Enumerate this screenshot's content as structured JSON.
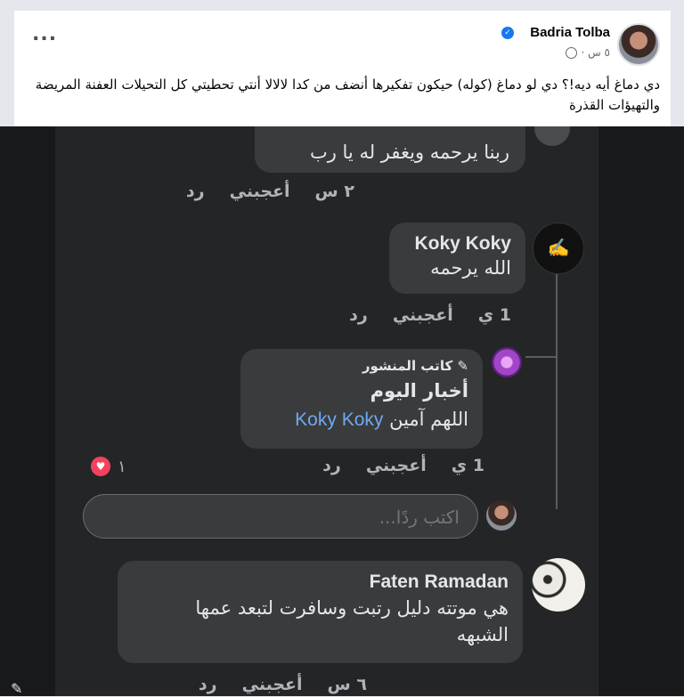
{
  "post": {
    "author": "Badria Tolba",
    "time": "٥ س ·",
    "text": "دي دماغ أيه ديه!؟ دي لو دماغ (كوله) حيكون تفكيرها أنضف من كدا لالالا أنتي تحطيتي كل التحيلات العفنة المريضة والتهيؤات القذرة",
    "more_label": "..."
  },
  "comments": {
    "top_partial": {
      "text": "ربنا يرحمه ويغفر له يا رب",
      "time": "٢ س",
      "like": "أعجبني",
      "reply": "رد"
    },
    "koky": {
      "name": "Koky Koky",
      "text": "الله يرحمه",
      "time": "1 ي",
      "like": "أعجبني",
      "reply": "رد"
    },
    "author_reply": {
      "badge": "كاتب المنشور",
      "name": "أخبار اليوم",
      "mention": "Koky Koky",
      "text": "اللهم آمين",
      "time": "1 ي",
      "like": "أعجبني",
      "reply": "رد",
      "reaction_count": "١"
    },
    "reply_input": {
      "placeholder": "اكتب ردًا..."
    },
    "faten": {
      "name": "Faten Ramadan",
      "text_line1": "هي موتته دليل رتبت وسافرت لتبعد عمها",
      "text_line2": "الشبهه",
      "time": "٦ س",
      "like": "أعجبني",
      "reply": "رد"
    }
  },
  "colors": {
    "dark_bg": "#18191a",
    "panel_bg": "#242526",
    "bubble_bg": "#3a3b3c",
    "mention": "#6fa8f2",
    "verified": "#1877f2",
    "heart": "#f3425f"
  }
}
